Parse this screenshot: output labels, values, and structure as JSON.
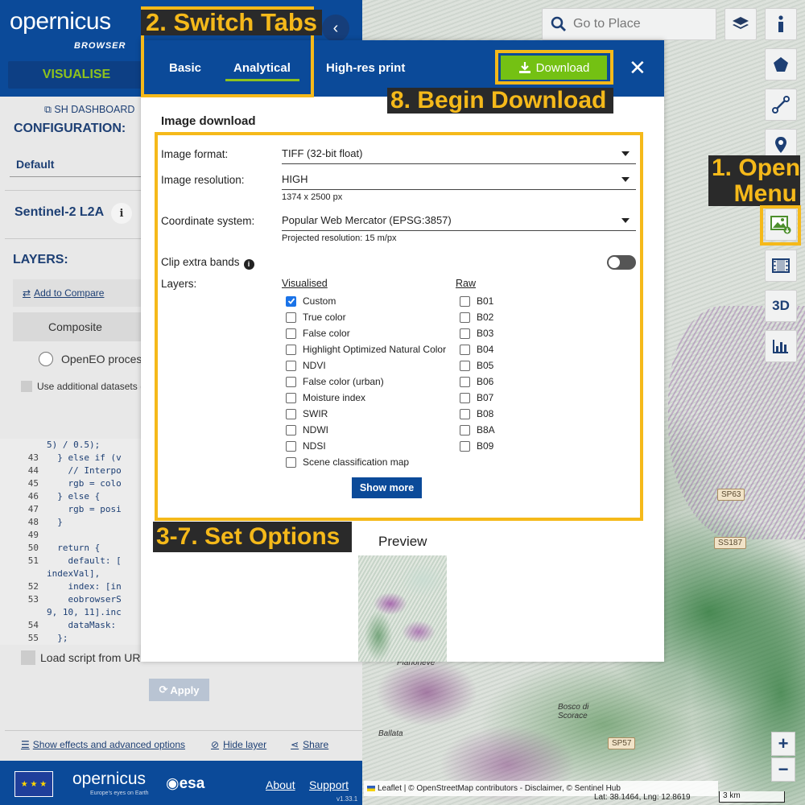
{
  "sidebar": {
    "logo": "opernicus",
    "logo_sub": "BROWSER",
    "visualise": "VISUALISE",
    "sh_dashboard": "SH DASHBOARD",
    "configuration_title": "CONFIGURATION:",
    "configuration_value": "Default",
    "collection": "Sentinel-2 L2A",
    "layers_title": "LAYERS:",
    "add_to_compare": "Add to Compare",
    "composite": "Composite",
    "openeo": "OpenEO proces",
    "additional_datasets": "Use additional datasets (",
    "code_lines": [
      {
        "n": "",
        "t": "5) / 0.5);"
      },
      {
        "n": "43",
        "t": "  } else if (v"
      },
      {
        "n": "44",
        "t": "    // Interpo"
      },
      {
        "n": "45",
        "t": "    rgb = colo"
      },
      {
        "n": "46",
        "t": "  } else {"
      },
      {
        "n": "47",
        "t": "    rgb = posi"
      },
      {
        "n": "48",
        "t": "  }"
      },
      {
        "n": "49",
        "t": ""
      },
      {
        "n": "50",
        "t": "  return {"
      },
      {
        "n": "51",
        "t": "    default: ["
      },
      {
        "n": "",
        "t": "indexVal],"
      },
      {
        "n": "52",
        "t": "    index: [in"
      },
      {
        "n": "53",
        "t": "    eobrowserS"
      },
      {
        "n": "",
        "t": "9, 10, 11].inc"
      },
      {
        "n": "54",
        "t": "    dataMask:"
      },
      {
        "n": "55",
        "t": "  };"
      }
    ],
    "load_script": "Load script from URL",
    "apply": "Apply",
    "show_effects": "Show effects and advanced options",
    "hide_layer": "Hide layer",
    "share": "Share",
    "footer": {
      "logo": "opernicus",
      "tagline": "Europe's eyes on Earth",
      "esa": "esa",
      "about": "About",
      "support": "Support",
      "version": "v1.33.1"
    }
  },
  "map": {
    "search_placeholder": "Go to Place",
    "road_badges": [
      "SP63",
      "SS187",
      "SP57"
    ],
    "places": [
      "Pianoneve",
      "Bosco di Scorace",
      "Ballata"
    ],
    "zoom_in": "+",
    "zoom_out": "−",
    "attribution": "Leaflet | © OpenStreetMap contributors - Disclaimer, © Sentinel Hub",
    "latlng": "Lat: 38.1464, Lng: 12.8619",
    "scale": "3 km",
    "tools": [
      "info-icon",
      "polygon-icon",
      "measure-icon",
      "location-pin-icon",
      "image-download-icon",
      "timelapse-film-icon",
      "3d-icon",
      "chart-icon"
    ],
    "tool_3d_label": "3D"
  },
  "dialog": {
    "tabs": [
      "Basic",
      "Analytical",
      "High-res print"
    ],
    "active_tab": "Analytical",
    "download_label": "Download",
    "close_label": "✕",
    "title": "Image download",
    "image_format_label": "Image format:",
    "image_format_value": "TIFF (32-bit float)",
    "image_resolution_label": "Image resolution:",
    "image_resolution_value": "HIGH",
    "resolution_hint": "1374 x 2500 px",
    "coord_label": "Coordinate system:",
    "coord_value": "Popular Web Mercator (EPSG:3857)",
    "coord_hint": "Projected resolution: 15 m/px",
    "clip_label": "Clip extra bands",
    "clip_enabled": false,
    "layers_label": "Layers:",
    "visualised_header": "Visualised",
    "raw_header": "Raw",
    "visualised": [
      {
        "label": "Custom",
        "checked": true
      },
      {
        "label": "True color",
        "checked": false
      },
      {
        "label": "False color",
        "checked": false
      },
      {
        "label": "Highlight Optimized Natural Color",
        "checked": false
      },
      {
        "label": "NDVI",
        "checked": false
      },
      {
        "label": "False color (urban)",
        "checked": false
      },
      {
        "label": "Moisture index",
        "checked": false
      },
      {
        "label": "SWIR",
        "checked": false
      },
      {
        "label": "NDWI",
        "checked": false
      },
      {
        "label": "NDSI",
        "checked": false
      },
      {
        "label": "Scene classification map",
        "checked": false
      }
    ],
    "raw": [
      {
        "label": "B01",
        "checked": false
      },
      {
        "label": "B02",
        "checked": false
      },
      {
        "label": "B03",
        "checked": false
      },
      {
        "label": "B04",
        "checked": false
      },
      {
        "label": "B05",
        "checked": false
      },
      {
        "label": "B06",
        "checked": false
      },
      {
        "label": "B07",
        "checked": false
      },
      {
        "label": "B08",
        "checked": false
      },
      {
        "label": "B8A",
        "checked": false
      },
      {
        "label": "B09",
        "checked": false
      }
    ],
    "show_more": "Show more",
    "preview_title": "Preview"
  },
  "annotations": {
    "switch_tabs": "2. Switch Tabs",
    "begin_download": "8. Begin Download",
    "open_menu_line1": "1. Open",
    "open_menu_line2": "Menu",
    "set_options": "3-7. Set Options"
  },
  "colors": {
    "brand_blue": "#0b4a99",
    "accent_green": "#8ec21d",
    "download_green": "#74c113",
    "annotation_yellow": "#f5b91a",
    "annotation_bg": "#2a2a2a"
  }
}
